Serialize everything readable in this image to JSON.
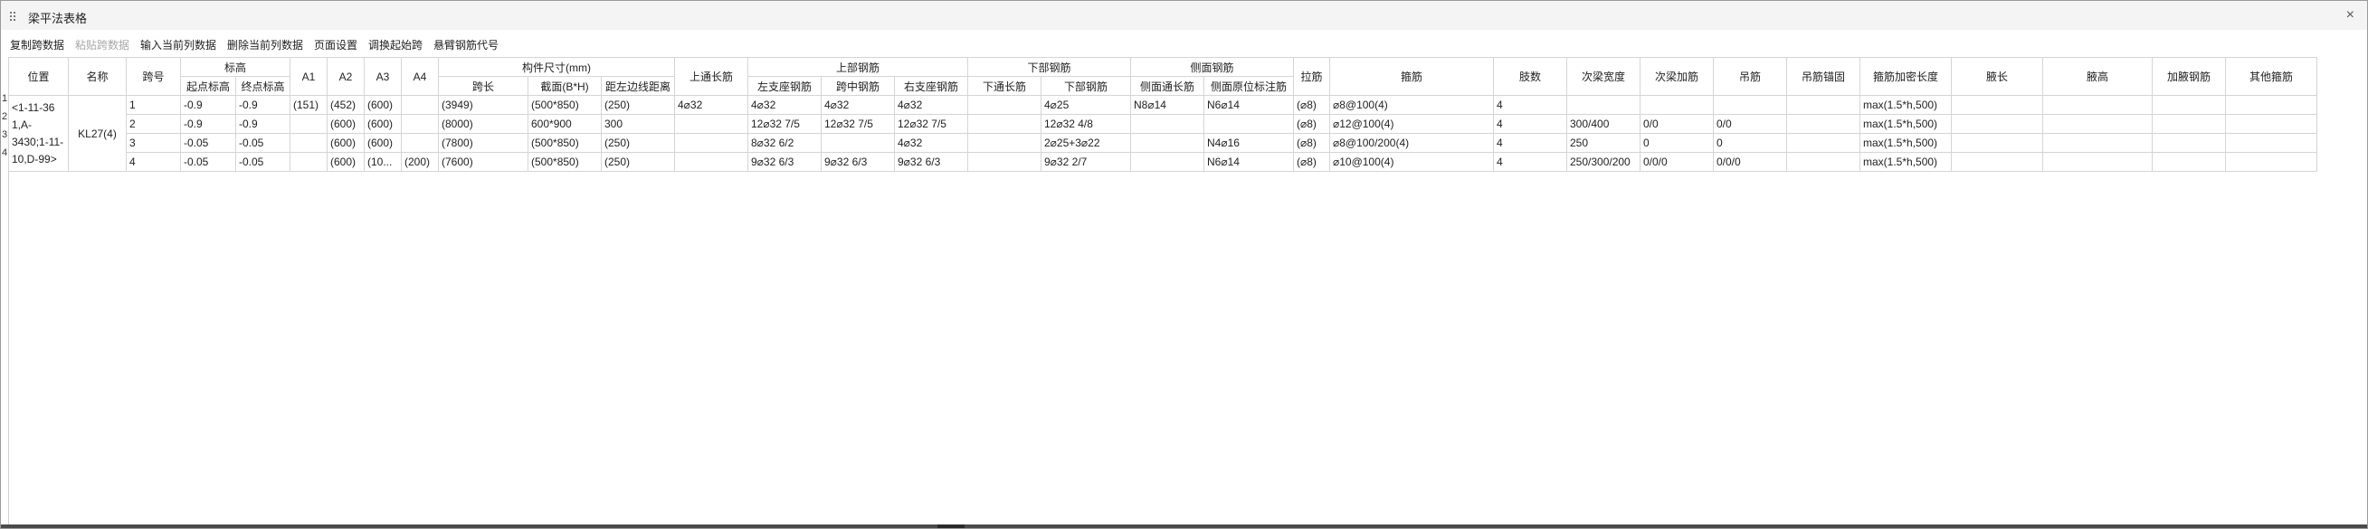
{
  "window": {
    "title": "梁平法表格",
    "close": "×"
  },
  "toolbar": [
    {
      "label": "复制跨数据",
      "disabled": false
    },
    {
      "label": "粘贴跨数据",
      "disabled": true
    },
    {
      "label": "输入当前列数据",
      "disabled": false
    },
    {
      "label": "删除当前列数据",
      "disabled": false
    },
    {
      "label": "页面设置",
      "disabled": false
    },
    {
      "label": "调换起始跨",
      "disabled": false
    },
    {
      "label": "悬臂钢筋代号",
      "disabled": false
    }
  ],
  "headers": {
    "position": "位置",
    "name": "名称",
    "span": "跨号",
    "elev_group": "标高",
    "elev_start": "起点标高",
    "elev_end": "终点标高",
    "a1": "A1",
    "a2": "A2",
    "a3": "A3",
    "a4": "A4",
    "size_group": "构件尺寸(mm)",
    "span_len": "跨长",
    "section": "截面(B*H)",
    "edge_dist": "距左边线距离",
    "top_through": "上通长筋",
    "top_group": "上部钢筋",
    "left_support": "左支座钢筋",
    "mid_span": "跨中钢筋",
    "right_support": "右支座钢筋",
    "bot_group": "下部钢筋",
    "bot_through": "下通长筋",
    "bot_bar": "下部钢筋",
    "side_group": "侧面钢筋",
    "side_through": "侧面通长筋",
    "side_orig": "侧面原位标注筋",
    "tie": "拉筋",
    "stirrup": "箍筋",
    "legs": "肢数",
    "sub_width": "次梁宽度",
    "sub_add": "次梁加筋",
    "hanger": "吊筋",
    "hanger_anchor": "吊筋锚固",
    "stirrup_dense": "箍筋加密长度",
    "haunch_len": "腋长",
    "haunch_h": "腋高",
    "haunch_bar": "加腋钢筋",
    "other": "其他箍筋"
  },
  "beam": {
    "position": "<1-11-36 1,A-3430;1-11-10,D-99>",
    "name": "KL27(4)"
  },
  "rows": [
    {
      "num": "1",
      "span": "1",
      "elev_start": "-0.9",
      "elev_end": "-0.9",
      "a1": "(151)",
      "a2": "(452)",
      "a3": "(600)",
      "a4": "",
      "span_len": "(3949)",
      "section": "(500*850)",
      "edge_dist": "(250)",
      "top_through": "4⌀32",
      "left_support": "4⌀32",
      "mid_span": "4⌀32",
      "right_support": "4⌀32",
      "bot_through": "",
      "bot_bar": "4⌀25",
      "side_through": "N8⌀14",
      "side_orig": "N6⌀14",
      "tie": "(⌀8)",
      "stirrup": "⌀8@100(4)",
      "legs": "4",
      "sub_width": "",
      "sub_add": "",
      "hanger": "",
      "hanger_anchor": "",
      "stirrup_dense": "max(1.5*h,500)"
    },
    {
      "num": "2",
      "span": "2",
      "elev_start": "-0.9",
      "elev_end": "-0.9",
      "a1": "",
      "a2": "(600)",
      "a3": "(600)",
      "a4": "",
      "span_len": "(8000)",
      "section": "600*900",
      "edge_dist": "300",
      "top_through": "",
      "left_support": "12⌀32 7/5",
      "mid_span": "12⌀32 7/5",
      "right_support": "12⌀32 7/5",
      "bot_through": "",
      "bot_bar": "12⌀32 4/8",
      "side_through": "",
      "side_orig": "",
      "tie": "(⌀8)",
      "stirrup": "⌀12@100(4)",
      "legs": "4",
      "sub_width": "300/400",
      "sub_add": "0/0",
      "hanger": "0/0",
      "hanger_anchor": "",
      "stirrup_dense": "max(1.5*h,500)"
    },
    {
      "num": "3",
      "span": "3",
      "elev_start": "-0.05",
      "elev_end": "-0.05",
      "a1": "",
      "a2": "(600)",
      "a3": "(600)",
      "a4": "",
      "span_len": "(7800)",
      "section": "(500*850)",
      "edge_dist": "(250)",
      "top_through": "",
      "left_support": "8⌀32 6/2",
      "mid_span": "",
      "right_support": "4⌀32",
      "bot_through": "",
      "bot_bar": "2⌀25+3⌀22",
      "side_through": "",
      "side_orig": "N4⌀16",
      "tie": "(⌀8)",
      "stirrup": "⌀8@100/200(4)",
      "legs": "4",
      "sub_width": "250",
      "sub_add": "0",
      "hanger": "0",
      "hanger_anchor": "",
      "stirrup_dense": "max(1.5*h,500)"
    },
    {
      "num": "4",
      "span": "4",
      "elev_start": "-0.05",
      "elev_end": "-0.05",
      "a1": "",
      "a2": "(600)",
      "a3": "(10...",
      "a4": "(200)",
      "span_len": "(7600)",
      "section": "(500*850)",
      "edge_dist": "(250)",
      "top_through": "",
      "left_support": "9⌀32 6/3",
      "mid_span": "9⌀32 6/3",
      "right_support": "9⌀32 6/3",
      "bot_through": "",
      "bot_bar": "9⌀32 2/7",
      "side_through": "",
      "side_orig": "N6⌀14",
      "tie": "(⌀8)",
      "stirrup": "⌀10@100(4)",
      "legs": "4",
      "sub_width": "250/300/200",
      "sub_add": "0/0/0",
      "hanger": "0/0/0",
      "hanger_anchor": "",
      "stirrup_dense": "max(1.5*h,500)"
    }
  ]
}
